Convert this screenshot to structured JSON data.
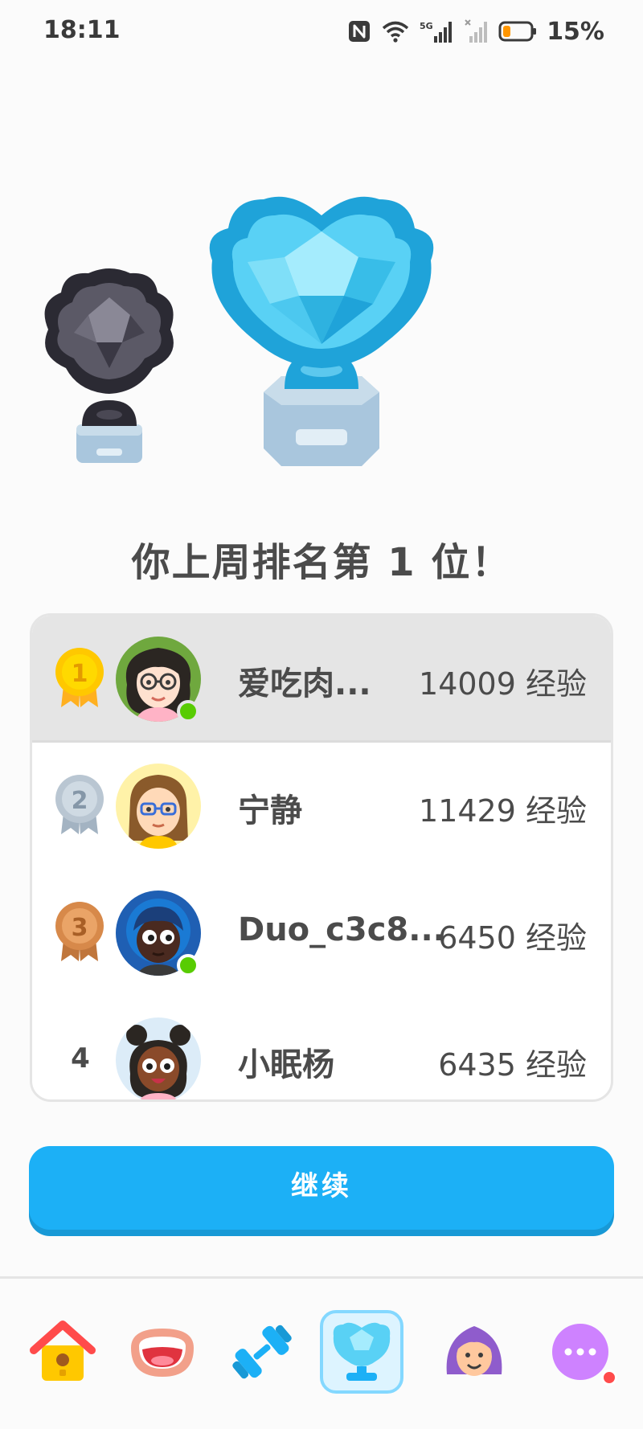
{
  "status_bar": {
    "time": "18:11",
    "network_label": "5G",
    "battery_percent": "15%",
    "icons": [
      "nfc-icon",
      "wifi-icon",
      "signal-5g-icon",
      "signal-no-service-icon",
      "battery-low-icon"
    ]
  },
  "result": {
    "heading": "你上周排名第 1 位！"
  },
  "leaderboard": [
    {
      "rank": "1",
      "medal": "gold",
      "name": "爱吃肉...",
      "xp": "14009 经验",
      "online": true,
      "highlight": true
    },
    {
      "rank": "2",
      "medal": "silver",
      "name": "宁静",
      "xp": "11429 经验",
      "online": false,
      "highlight": false
    },
    {
      "rank": "3",
      "medal": "bronze",
      "name": "Duo_c3c8...",
      "xp": "6450 经验",
      "online": true,
      "highlight": false
    },
    {
      "rank": "4",
      "medal": "none",
      "name": "小眠杨",
      "xp": "6435 经验",
      "online": false,
      "highlight": false
    }
  ],
  "continue_button": {
    "label": "继续"
  },
  "bottom_nav": [
    {
      "name": "home",
      "icon": "birdhouse-icon",
      "active": false
    },
    {
      "name": "speaking",
      "icon": "mouth-icon",
      "active": false
    },
    {
      "name": "practice",
      "icon": "dumbbell-icon",
      "active": false
    },
    {
      "name": "leaderboards",
      "icon": "diamond-trophy-icon",
      "active": true
    },
    {
      "name": "profile",
      "icon": "profile-avatar-icon",
      "active": false
    },
    {
      "name": "more",
      "icon": "more-dots-icon",
      "active": false,
      "notification_dot": true
    }
  ],
  "colors": {
    "accent_blue": "#1cb0f6",
    "accent_blue_shadow": "#1899d6",
    "online_green": "#58cc02",
    "highlight_row": "#e5e5e5",
    "gold": "#ffc800",
    "silver": "#b9c6d2",
    "bronze": "#d7894a"
  }
}
